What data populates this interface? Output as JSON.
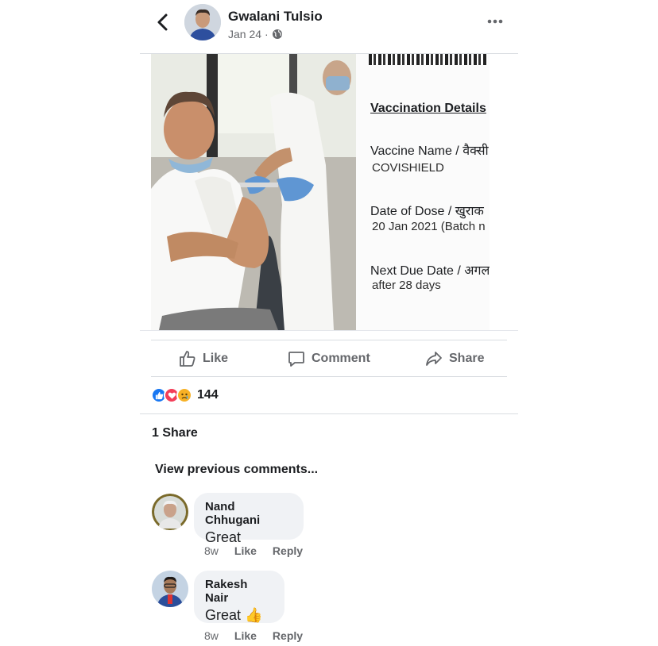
{
  "post": {
    "author": "Gwalani Tulsio",
    "date": "Jan 24",
    "separator": "·",
    "audience_icon": "globe-icon"
  },
  "vaccination_card": {
    "title": "Vaccination Details",
    "vaccine_label": "Vaccine Name / वैक्सी",
    "vaccine_value": "COVISHIELD",
    "dose_label": "Date of Dose / खुराक",
    "dose_value": "20 Jan 2021 (Batch n",
    "next_label": "Next Due Date / अगल",
    "next_value": "after 28 days"
  },
  "actions": {
    "like": "Like",
    "comment": "Comment",
    "share": "Share"
  },
  "stats": {
    "reactions": [
      "like-reaction-icon",
      "love-reaction-icon",
      "sad-reaction-icon"
    ],
    "reaction_count": "144",
    "shares": "1 Share"
  },
  "comments_section": {
    "view_previous": "View previous comments...",
    "comments": [
      {
        "author": "Nand Chhugani",
        "text": "Great",
        "time": "8w",
        "like": "Like",
        "reply": "Reply"
      },
      {
        "author": "Rakesh Nair",
        "text": "Great 👍",
        "time": "8w",
        "like": "Like",
        "reply": "Reply"
      }
    ]
  },
  "colors": {
    "text": "#1c1e21",
    "muted": "#65676b",
    "like_blue": "#1877f2",
    "love_red": "#f33e58",
    "sad_yellow": "#f7b125",
    "bubble": "#f0f2f5"
  }
}
